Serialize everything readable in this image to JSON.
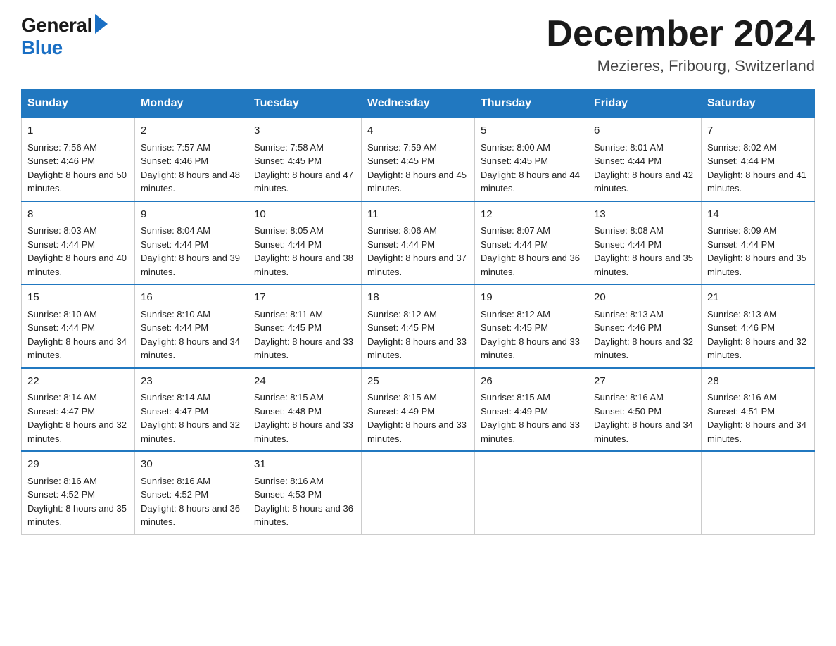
{
  "header": {
    "logo_general": "General",
    "logo_blue": "Blue",
    "month_title": "December 2024",
    "location": "Mezieres, Fribourg, Switzerland"
  },
  "weekdays": [
    "Sunday",
    "Monday",
    "Tuesday",
    "Wednesday",
    "Thursday",
    "Friday",
    "Saturday"
  ],
  "weeks": [
    [
      {
        "day": "1",
        "sunrise": "7:56 AM",
        "sunset": "4:46 PM",
        "daylight": "8 hours and 50 minutes."
      },
      {
        "day": "2",
        "sunrise": "7:57 AM",
        "sunset": "4:46 PM",
        "daylight": "8 hours and 48 minutes."
      },
      {
        "day": "3",
        "sunrise": "7:58 AM",
        "sunset": "4:45 PM",
        "daylight": "8 hours and 47 minutes."
      },
      {
        "day": "4",
        "sunrise": "7:59 AM",
        "sunset": "4:45 PM",
        "daylight": "8 hours and 45 minutes."
      },
      {
        "day": "5",
        "sunrise": "8:00 AM",
        "sunset": "4:45 PM",
        "daylight": "8 hours and 44 minutes."
      },
      {
        "day": "6",
        "sunrise": "8:01 AM",
        "sunset": "4:44 PM",
        "daylight": "8 hours and 42 minutes."
      },
      {
        "day": "7",
        "sunrise": "8:02 AM",
        "sunset": "4:44 PM",
        "daylight": "8 hours and 41 minutes."
      }
    ],
    [
      {
        "day": "8",
        "sunrise": "8:03 AM",
        "sunset": "4:44 PM",
        "daylight": "8 hours and 40 minutes."
      },
      {
        "day": "9",
        "sunrise": "8:04 AM",
        "sunset": "4:44 PM",
        "daylight": "8 hours and 39 minutes."
      },
      {
        "day": "10",
        "sunrise": "8:05 AM",
        "sunset": "4:44 PM",
        "daylight": "8 hours and 38 minutes."
      },
      {
        "day": "11",
        "sunrise": "8:06 AM",
        "sunset": "4:44 PM",
        "daylight": "8 hours and 37 minutes."
      },
      {
        "day": "12",
        "sunrise": "8:07 AM",
        "sunset": "4:44 PM",
        "daylight": "8 hours and 36 minutes."
      },
      {
        "day": "13",
        "sunrise": "8:08 AM",
        "sunset": "4:44 PM",
        "daylight": "8 hours and 35 minutes."
      },
      {
        "day": "14",
        "sunrise": "8:09 AM",
        "sunset": "4:44 PM",
        "daylight": "8 hours and 35 minutes."
      }
    ],
    [
      {
        "day": "15",
        "sunrise": "8:10 AM",
        "sunset": "4:44 PM",
        "daylight": "8 hours and 34 minutes."
      },
      {
        "day": "16",
        "sunrise": "8:10 AM",
        "sunset": "4:44 PM",
        "daylight": "8 hours and 34 minutes."
      },
      {
        "day": "17",
        "sunrise": "8:11 AM",
        "sunset": "4:45 PM",
        "daylight": "8 hours and 33 minutes."
      },
      {
        "day": "18",
        "sunrise": "8:12 AM",
        "sunset": "4:45 PM",
        "daylight": "8 hours and 33 minutes."
      },
      {
        "day": "19",
        "sunrise": "8:12 AM",
        "sunset": "4:45 PM",
        "daylight": "8 hours and 33 minutes."
      },
      {
        "day": "20",
        "sunrise": "8:13 AM",
        "sunset": "4:46 PM",
        "daylight": "8 hours and 32 minutes."
      },
      {
        "day": "21",
        "sunrise": "8:13 AM",
        "sunset": "4:46 PM",
        "daylight": "8 hours and 32 minutes."
      }
    ],
    [
      {
        "day": "22",
        "sunrise": "8:14 AM",
        "sunset": "4:47 PM",
        "daylight": "8 hours and 32 minutes."
      },
      {
        "day": "23",
        "sunrise": "8:14 AM",
        "sunset": "4:47 PM",
        "daylight": "8 hours and 32 minutes."
      },
      {
        "day": "24",
        "sunrise": "8:15 AM",
        "sunset": "4:48 PM",
        "daylight": "8 hours and 33 minutes."
      },
      {
        "day": "25",
        "sunrise": "8:15 AM",
        "sunset": "4:49 PM",
        "daylight": "8 hours and 33 minutes."
      },
      {
        "day": "26",
        "sunrise": "8:15 AM",
        "sunset": "4:49 PM",
        "daylight": "8 hours and 33 minutes."
      },
      {
        "day": "27",
        "sunrise": "8:16 AM",
        "sunset": "4:50 PM",
        "daylight": "8 hours and 34 minutes."
      },
      {
        "day": "28",
        "sunrise": "8:16 AM",
        "sunset": "4:51 PM",
        "daylight": "8 hours and 34 minutes."
      }
    ],
    [
      {
        "day": "29",
        "sunrise": "8:16 AM",
        "sunset": "4:52 PM",
        "daylight": "8 hours and 35 minutes."
      },
      {
        "day": "30",
        "sunrise": "8:16 AM",
        "sunset": "4:52 PM",
        "daylight": "8 hours and 36 minutes."
      },
      {
        "day": "31",
        "sunrise": "8:16 AM",
        "sunset": "4:53 PM",
        "daylight": "8 hours and 36 minutes."
      },
      null,
      null,
      null,
      null
    ]
  ]
}
